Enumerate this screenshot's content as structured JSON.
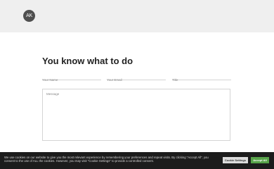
{
  "header": {
    "logo_text": "AK",
    "background_color": "#efefef"
  },
  "form": {
    "title": "You know what to do",
    "name_placeholder": "Your Name",
    "email_placeholder": "Your Email",
    "title_placeholder": "Title",
    "message_placeholder": "Message"
  },
  "cookie_bar": {
    "text": "We use cookies on our website to give you the most relevant experience by remembering your preferences and repeat visits. By clicking “Accept All”, you consent to the use of ALL the cookies. However, you may visit \"Cookie Settings\" to provide a controlled consent.",
    "settings_label": "Cookie Settings",
    "accept_label": "Accept All",
    "accept_color": "#58a34a",
    "background_color": "#1c1c1c"
  }
}
